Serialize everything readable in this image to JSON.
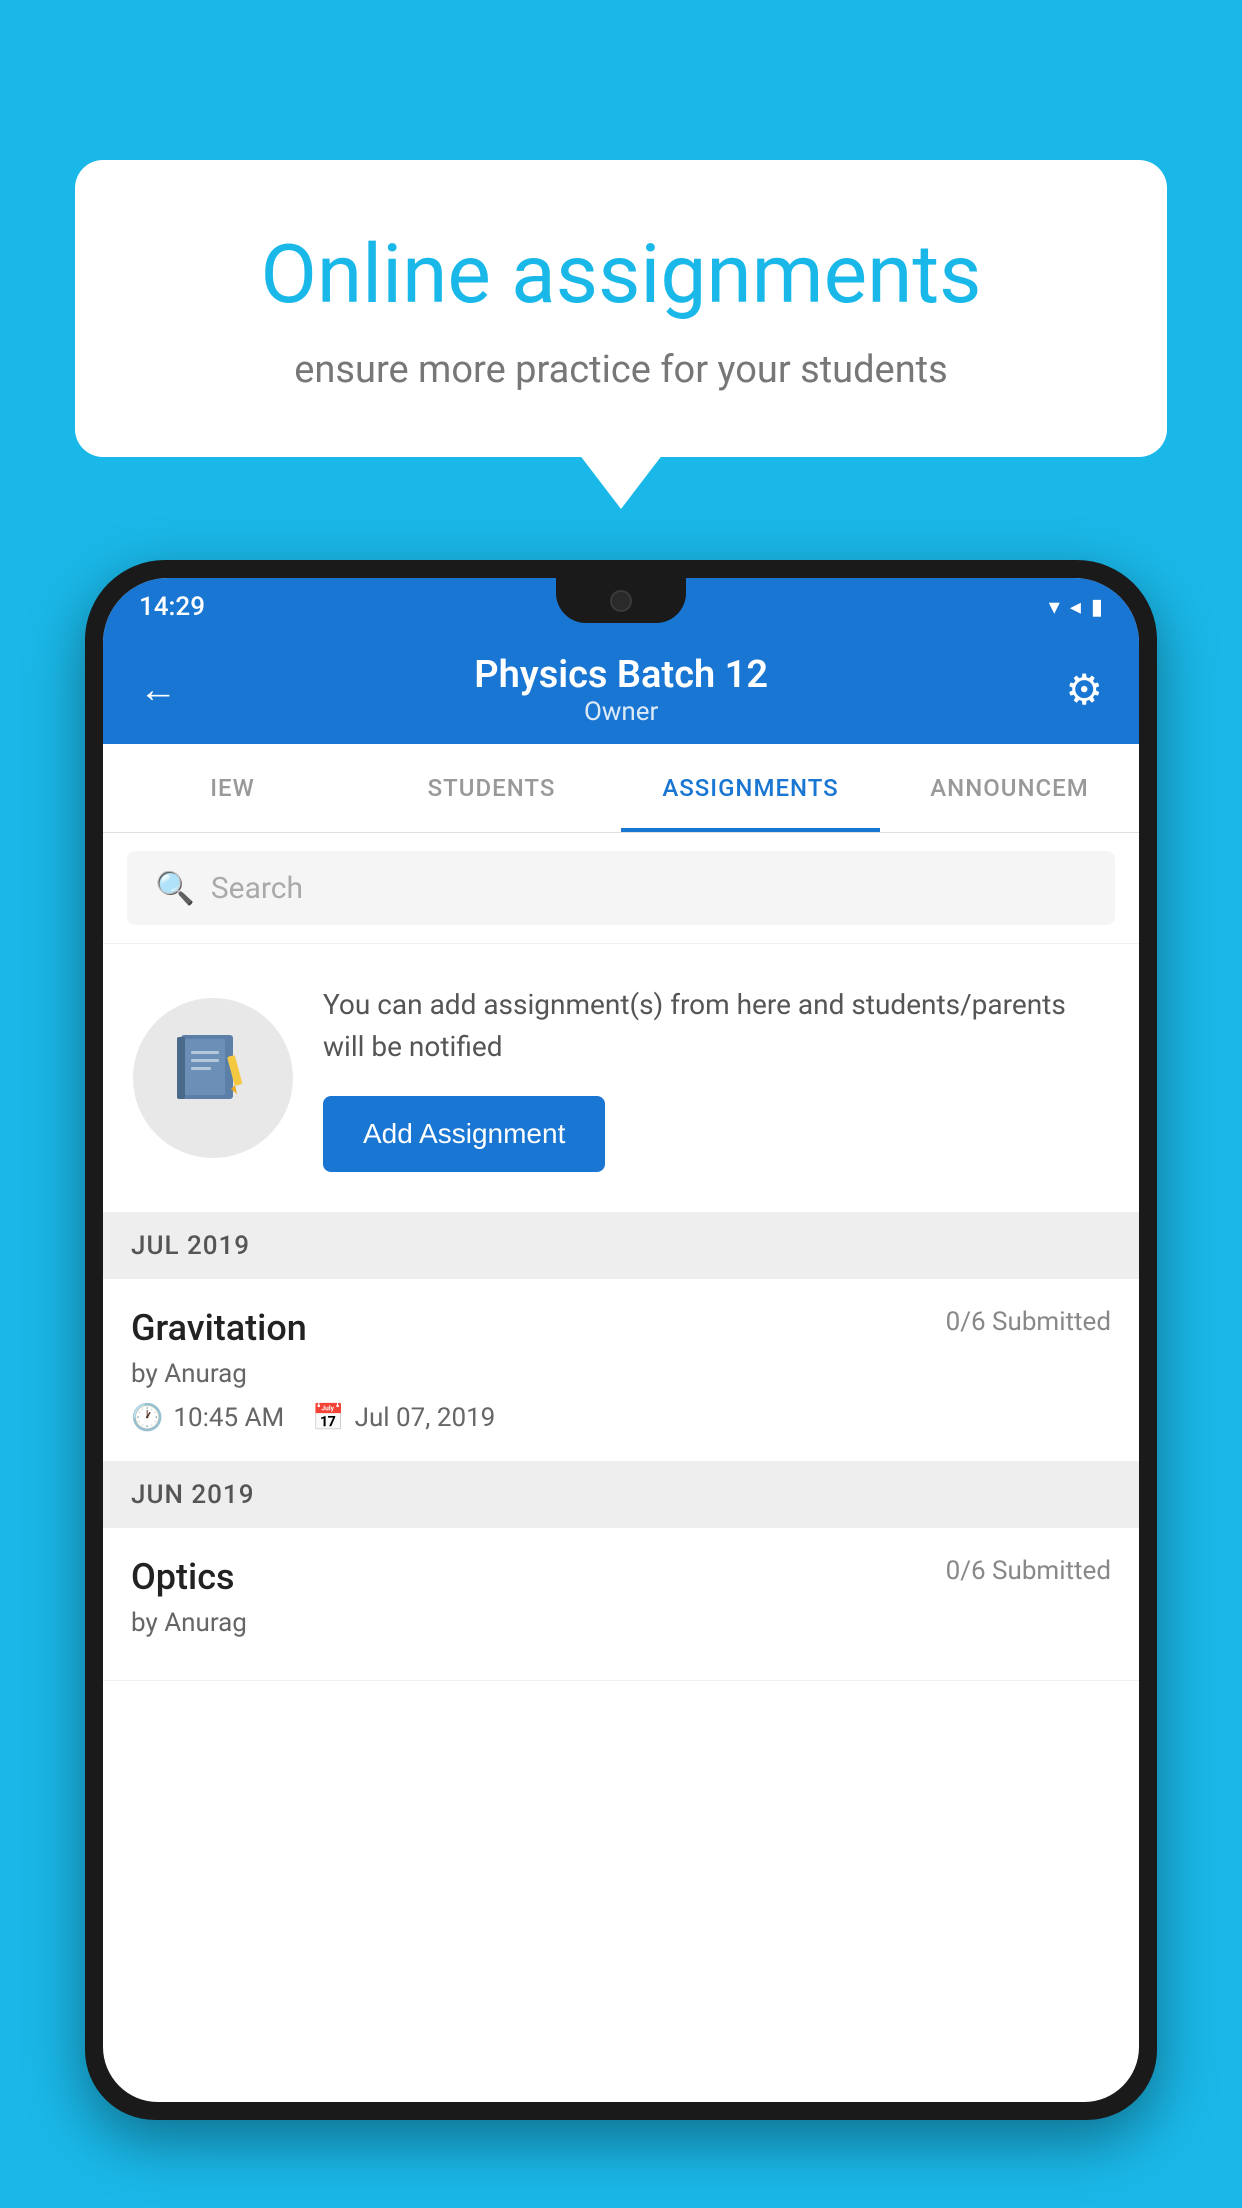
{
  "background_color": "#1ab8e8",
  "speech_bubble": {
    "title": "Online assignments",
    "subtitle": "ensure more practice for your students"
  },
  "status_bar": {
    "time": "14:29",
    "wifi": "wifi-icon",
    "signal": "signal-icon",
    "battery": "battery-icon"
  },
  "app_header": {
    "back_label": "←",
    "title": "Physics Batch 12",
    "subtitle": "Owner",
    "settings_icon": "⚙"
  },
  "tabs": [
    {
      "label": "IEW",
      "active": false
    },
    {
      "label": "STUDENTS",
      "active": false
    },
    {
      "label": "ASSIGNMENTS",
      "active": true
    },
    {
      "label": "ANNOUNCEM",
      "active": false
    }
  ],
  "search": {
    "placeholder": "Search"
  },
  "info_card": {
    "description": "You can add assignment(s) from here and students/parents will be notified",
    "button_label": "Add Assignment"
  },
  "months": [
    {
      "label": "JUL 2019",
      "assignments": [
        {
          "name": "Gravitation",
          "submitted": "0/6 Submitted",
          "by": "by Anurag",
          "time": "10:45 AM",
          "date": "Jul 07, 2019"
        }
      ]
    },
    {
      "label": "JUN 2019",
      "assignments": [
        {
          "name": "Optics",
          "submitted": "0/6 Submitted",
          "by": "by Anurag",
          "time": "",
          "date": ""
        }
      ]
    }
  ]
}
